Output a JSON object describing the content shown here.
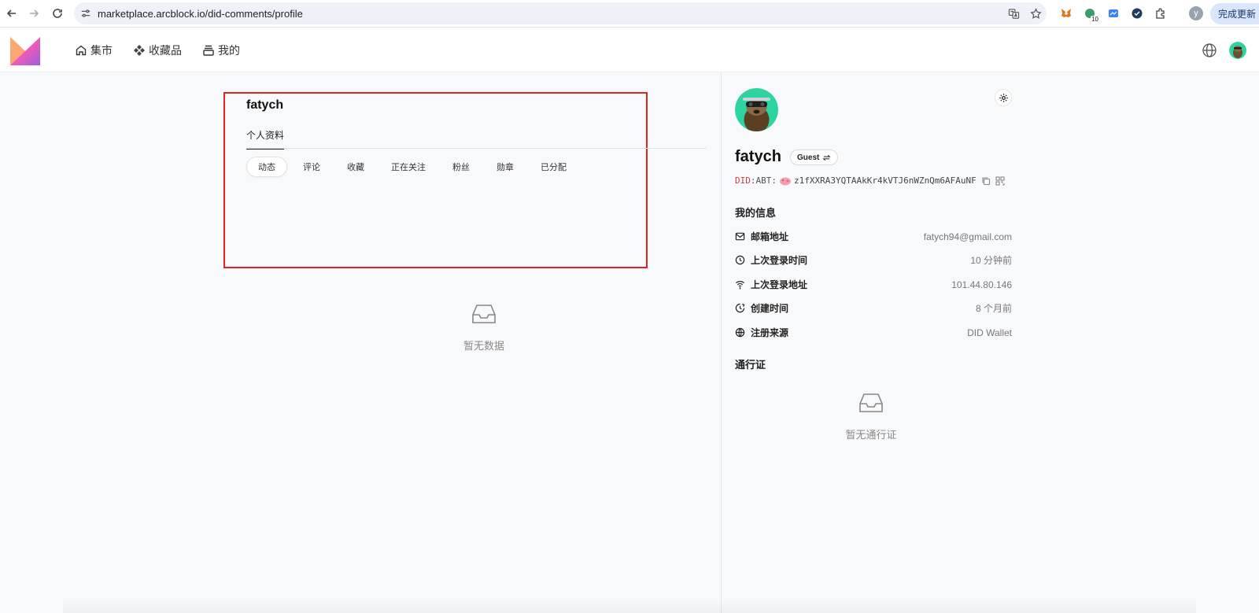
{
  "browser": {
    "url": "marketplace.arcblock.io/did-comments/profile",
    "profile_initial": "y",
    "update_label": "完成更新",
    "extension_badge": "10"
  },
  "header": {
    "nav": [
      {
        "label": "集市",
        "icon": "home-icon"
      },
      {
        "label": "收藏品",
        "icon": "diamond-grid-icon"
      },
      {
        "label": "我的",
        "icon": "stack-icon"
      }
    ]
  },
  "main": {
    "username": "fatych",
    "section_tab": "个人资料",
    "sub_tabs": [
      "动态",
      "评论",
      "收藏",
      "正在关注",
      "粉丝",
      "勋章",
      "已分配"
    ],
    "active_sub_tab": 0,
    "empty_text": "暂无数据"
  },
  "profile": {
    "name": "fatych",
    "role_badge": "Guest",
    "did_prefix": "DID",
    "did_chain": ":ABT:",
    "did_value": "z1fXXRA3YQTAAkKr4kVTJ6nWZnQm6AFAuNF",
    "info_heading": "我的信息",
    "info": [
      {
        "icon": "mail-icon",
        "label": "邮箱地址",
        "value": "fatych94@gmail.com"
      },
      {
        "icon": "clock-icon",
        "label": "上次登录时间",
        "value": "10 分钟前"
      },
      {
        "icon": "wifi-location-icon",
        "label": "上次登录地址",
        "value": "101.44.80.146"
      },
      {
        "icon": "history-icon",
        "label": "创建时间",
        "value": "8 个月前"
      },
      {
        "icon": "globe-source-icon",
        "label": "注册来源",
        "value": "DID Wallet"
      }
    ],
    "pass_heading": "通行证",
    "pass_empty_text": "暂无通行证"
  },
  "colors": {
    "highlight_border": "#e02424",
    "did_prefix": "#d23b3b",
    "avatar_bg": "#2dd4a0"
  }
}
